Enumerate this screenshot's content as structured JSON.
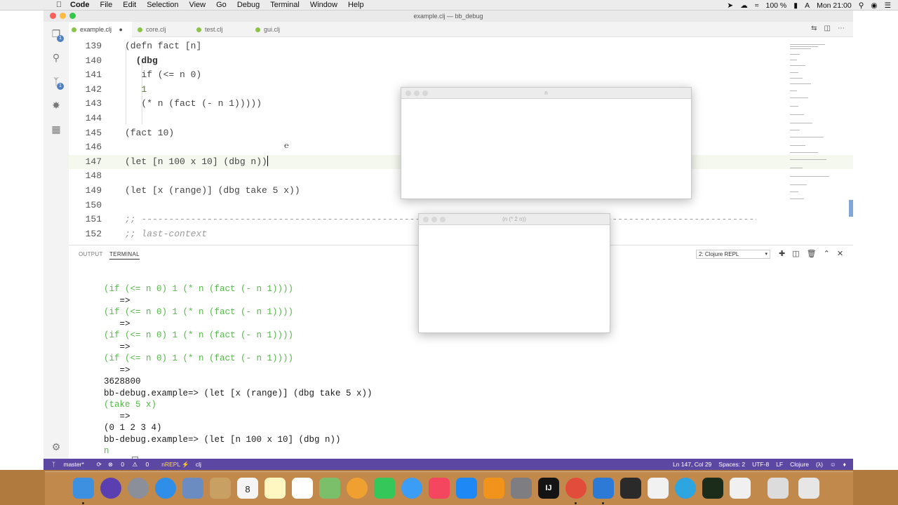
{
  "menubar": {
    "app": "Code",
    "items": [
      "File",
      "Edit",
      "Selection",
      "View",
      "Go",
      "Debug",
      "Terminal",
      "Window",
      "Help"
    ],
    "battery": "100 %",
    "clock": "Mon 21:00"
  },
  "window": {
    "title": "example.clj — bb_debug"
  },
  "tabs": [
    {
      "label": "example.clj",
      "active": true,
      "dirty_marker": "●"
    },
    {
      "label": "core.clj",
      "active": false
    },
    {
      "label": "test.clj",
      "active": false
    },
    {
      "label": "gui.clj",
      "active": false
    }
  ],
  "activity_badges": {
    "explorer": "1",
    "scm": "1"
  },
  "editor": {
    "lines": [
      {
        "n": "139",
        "text": "(defn fact [n]"
      },
      {
        "n": "140",
        "text": "  (dbg"
      },
      {
        "n": "141",
        "text": "   if (<= n 0)"
      },
      {
        "n": "142",
        "text": "   1"
      },
      {
        "n": "143",
        "text": "   (* n (fact (- n 1)))))"
      },
      {
        "n": "144",
        "text": ""
      },
      {
        "n": "145",
        "text": "(fact 10)"
      },
      {
        "n": "146",
        "text": ""
      },
      {
        "n": "147",
        "text": "(let [n 100 x 10] (dbg n))"
      },
      {
        "n": "148",
        "text": ""
      },
      {
        "n": "149",
        "text": "(let [x (range)] (dbg take 5 x))"
      },
      {
        "n": "150",
        "text": ""
      },
      {
        "n": "151",
        "text": ";; ------------------------------------------------------------------------------------------------------------------------"
      },
      {
        "n": "152",
        "text": ";; last-context"
      }
    ]
  },
  "panel": {
    "tabs": [
      "OUTPUT",
      "TERMINAL"
    ],
    "active_tab": "TERMINAL",
    "repl_select": "2: Clojure REPL",
    "terminal": [
      {
        "text": "(if (<= n 0) 1 (* n (fact (- n 1))))",
        "color": "green"
      },
      {
        "text": "   =>",
        "color": "dark"
      },
      {
        "text": "(if (<= n 0) 1 (* n (fact (- n 1))))",
        "color": "green"
      },
      {
        "text": "   =>",
        "color": "dark"
      },
      {
        "text": "(if (<= n 0) 1 (* n (fact (- n 1))))",
        "color": "green"
      },
      {
        "text": "   =>",
        "color": "dark"
      },
      {
        "text": "(if (<= n 0) 1 (* n (fact (- n 1))))",
        "color": "green"
      },
      {
        "text": "   =>",
        "color": "dark"
      },
      {
        "text": "3628800",
        "color": "dark"
      },
      {
        "text": "bb-debug.example=> (let [x (range)] (dbg take 5 x))",
        "color": "dark"
      },
      {
        "text": "(take 5 x)",
        "color": "green"
      },
      {
        "text": "   =>",
        "color": "dark"
      },
      {
        "text": "(0 1 2 3 4)",
        "color": "dark"
      },
      {
        "text": "bb-debug.example=> (let [n 100 x 10] (dbg n))",
        "color": "dark"
      },
      {
        "text": "n",
        "color": "green"
      },
      {
        "text": "   =>",
        "color": "dark"
      }
    ]
  },
  "statusbar": {
    "branch": "master*",
    "errors": "0",
    "warnings": "0",
    "nrepl": "nREPL ⚡",
    "ns": "clj",
    "position": "Ln 147, Col 29",
    "spaces": "Spaces: 2",
    "encoding": "UTF-8",
    "eol": "LF",
    "language": "Clojure",
    "lambda": "(λ)"
  },
  "float_windows": [
    {
      "title": "n"
    },
    {
      "title": "(n (* 2 n))"
    }
  ],
  "dock": {
    "calendar_day": "8"
  },
  "colors": {
    "statusbar": "#5c48a3",
    "accent": "#4f7fbf",
    "terminal_green": "#56b84a"
  }
}
